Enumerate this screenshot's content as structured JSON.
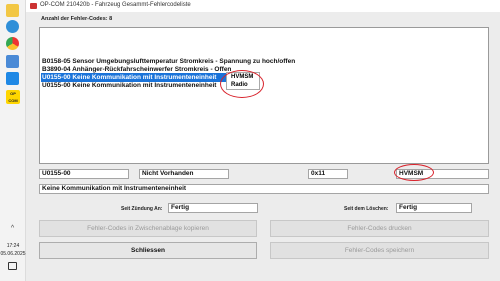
{
  "window": {
    "title": "OP-COM 210420b - Fahrzeug Gesammt-Fehlercodeliste"
  },
  "taskbar": {
    "time": "17:24",
    "date": "05.06.2025"
  },
  "count_label": "Anzahl der Fehler-Codes: 8",
  "codes": [
    "B0158-05 Sensor Umgebungslufttemperatur Stromkreis - Spannung zu hoch/offen",
    "B3890-04 Anhänger-Rückfahrscheinwerfer Stromkreis - Offen",
    "U0155-00 Keine Kommunikation mit Instrumenteneinheit",
    "U0155-00 Keine Kommunikation mit Instrumenteneinheit"
  ],
  "popup": [
    "HVMSM",
    "Radio"
  ],
  "details": {
    "code": "U0155-00",
    "status": "Nicht Vorhanden",
    "hex": "0x11",
    "module": "HVMSM",
    "description": "Keine Kommunikation mit Instrumenteneinheit"
  },
  "since_ignition": {
    "label": "Seit Zündung An:",
    "value": "Fertig"
  },
  "since_clear": {
    "label": "Seit dem Löschen:",
    "value": "Fertig"
  },
  "buttons": {
    "copy": "Fehler-Codes in Zwischenablage kopieren",
    "print": "Fehler-Codes drucken",
    "close": "Schliessen",
    "save": "Fehler-Codes speichern"
  },
  "colors": {
    "selection": "#1a73d9",
    "highlight_circle": "#d8222b"
  }
}
